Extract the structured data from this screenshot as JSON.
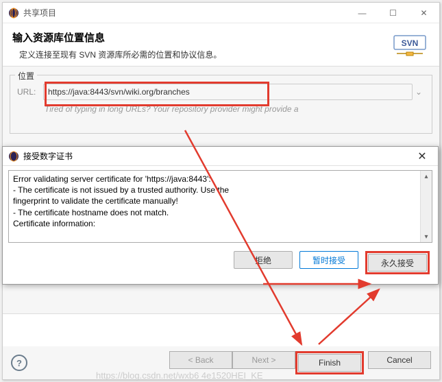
{
  "window": {
    "title": "共享项目",
    "minimize": "—",
    "maximize": "☐",
    "close": "✕"
  },
  "header": {
    "title": "输入资源库位置信息",
    "desc": "定义连接至现有 SVN 资源库所必需的位置和协议信息。",
    "svn_label": "SVN"
  },
  "location": {
    "legend": "位置",
    "url_label": "URL:",
    "url_value": "https://java:8443/svn/wiki.org/branches",
    "hint": "Tired of typing in long URLs?  Your repository provider might provide a"
  },
  "dialog": {
    "title": "接受数字证书",
    "close": "✕",
    "lines": [
      "Error validating server certificate for 'https://java:8443':",
      " - The certificate is not issued by a trusted authority. Use the",
      "   fingerprint to validate the certificate manually!",
      " - The certificate hostname does not match.",
      "Certificate information:"
    ],
    "buttons": {
      "reject": "拒绝",
      "temp": "暂时接受",
      "perm": "永久接受"
    }
  },
  "footer": {
    "back": "< Back",
    "next": "Next >",
    "finish": "Finish",
    "cancel": "Cancel",
    "help": "?"
  },
  "watermark": "https://blog.csdn.net/wxb6 4e1520HEI_KE"
}
